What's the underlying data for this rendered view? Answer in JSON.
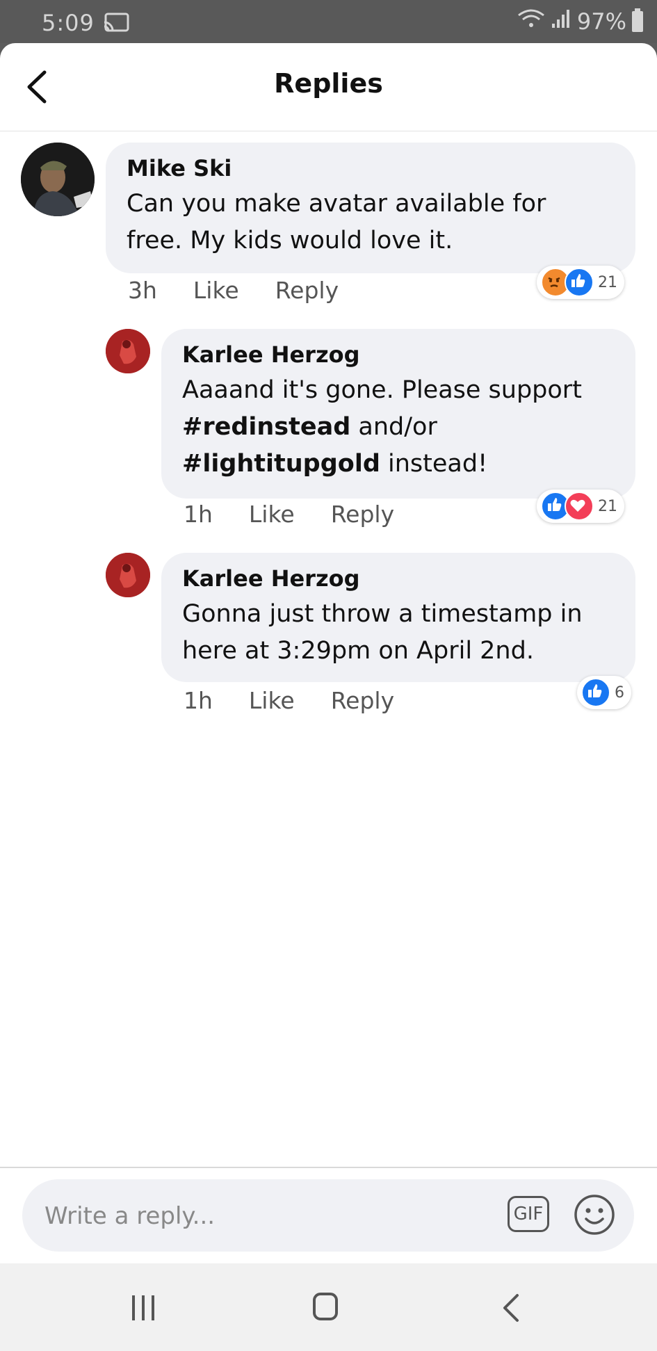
{
  "status_bar": {
    "time": "5:09",
    "battery": "97%"
  },
  "header": {
    "title": "Replies"
  },
  "comments": [
    {
      "author": "Mike Ski",
      "text_lines": [
        "Can you make avatar available for",
        "free. My kids would love it."
      ],
      "time": "3h",
      "like_label": "Like",
      "reply_label": "Reply",
      "reaction_icons": [
        "angry-reaction",
        "like-reaction"
      ],
      "reaction_count": "21"
    },
    {
      "author": "Karlee Herzog",
      "text_line1": "Aaaand it's gone. Please support",
      "hashtag1": "#redinstead",
      "text_and_or": " and/or",
      "hashtag2": "#lightitupgold",
      "text_end": " instead!",
      "time": "1h",
      "like_label": "Like",
      "reply_label": "Reply",
      "reaction_icons": [
        "like-reaction",
        "love-reaction"
      ],
      "reaction_count": "21"
    },
    {
      "author": "Karlee Herzog",
      "text_lines": [
        "Gonna just throw a timestamp in",
        "here at 3:29pm on April 2nd."
      ],
      "time": "1h",
      "like_label": "Like",
      "reply_label": "Reply",
      "reaction_icons": [
        "like-reaction"
      ],
      "reaction_count": "6"
    }
  ],
  "composer": {
    "placeholder": "Write a reply...",
    "gif_label": "GIF"
  },
  "colors": {
    "like_blue": "#1877f2",
    "love_red": "#f33e58",
    "angry_orange": "#f28a2e",
    "bubble_bg": "#f0f1f5"
  }
}
